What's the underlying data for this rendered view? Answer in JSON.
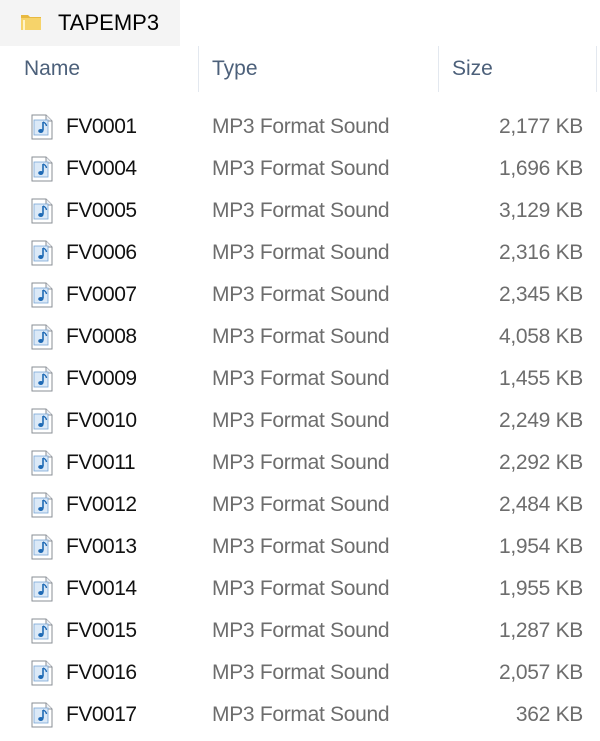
{
  "window": {
    "folder_title": "TAPEMP3",
    "folder_icon": "folder-icon"
  },
  "columns": {
    "name": "Name",
    "type": "Type",
    "size": "Size"
  },
  "files": [
    {
      "name": "FV0001",
      "type": "MP3 Format Sound",
      "size": "2,177 KB",
      "icon": "mp3-file-icon"
    },
    {
      "name": "FV0004",
      "type": "MP3 Format Sound",
      "size": "1,696 KB",
      "icon": "mp3-file-icon"
    },
    {
      "name": "FV0005",
      "type": "MP3 Format Sound",
      "size": "3,129 KB",
      "icon": "mp3-file-icon"
    },
    {
      "name": "FV0006",
      "type": "MP3 Format Sound",
      "size": "2,316 KB",
      "icon": "mp3-file-icon"
    },
    {
      "name": "FV0007",
      "type": "MP3 Format Sound",
      "size": "2,345 KB",
      "icon": "mp3-file-icon"
    },
    {
      "name": "FV0008",
      "type": "MP3 Format Sound",
      "size": "4,058 KB",
      "icon": "mp3-file-icon"
    },
    {
      "name": "FV0009",
      "type": "MP3 Format Sound",
      "size": "1,455 KB",
      "icon": "mp3-file-icon"
    },
    {
      "name": "FV0010",
      "type": "MP3 Format Sound",
      "size": "2,249 KB",
      "icon": "mp3-file-icon"
    },
    {
      "name": "FV0011",
      "type": "MP3 Format Sound",
      "size": "2,292 KB",
      "icon": "mp3-file-icon"
    },
    {
      "name": "FV0012",
      "type": "MP3 Format Sound",
      "size": "2,484 KB",
      "icon": "mp3-file-icon"
    },
    {
      "name": "FV0013",
      "type": "MP3 Format Sound",
      "size": "1,954 KB",
      "icon": "mp3-file-icon"
    },
    {
      "name": "FV0014",
      "type": "MP3 Format Sound",
      "size": "1,955 KB",
      "icon": "mp3-file-icon"
    },
    {
      "name": "FV0015",
      "type": "MP3 Format Sound",
      "size": "1,287 KB",
      "icon": "mp3-file-icon"
    },
    {
      "name": "FV0016",
      "type": "MP3 Format Sound",
      "size": "2,057 KB",
      "icon": "mp3-file-icon"
    },
    {
      "name": "FV0017",
      "type": "MP3 Format Sound",
      "size": "362 KB",
      "icon": "mp3-file-icon"
    }
  ],
  "colors": {
    "header_text": "#4c607a",
    "type_text": "#6d6d6d",
    "name_text": "#111111",
    "folder_yellow": "#f0c95a",
    "music_note_blue": "#2b78c2"
  }
}
